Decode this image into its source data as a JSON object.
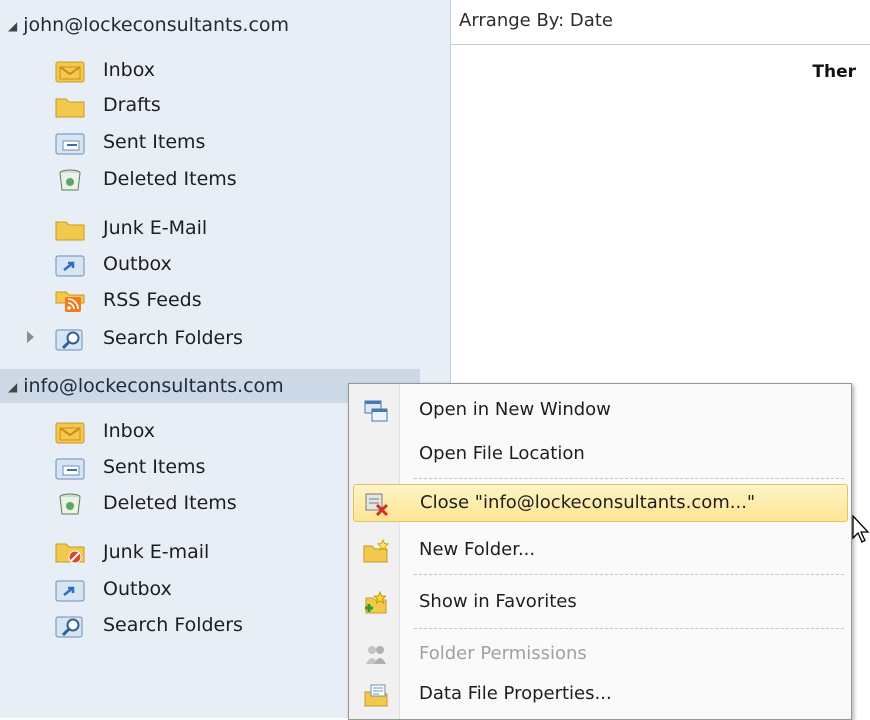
{
  "navigation": {
    "accounts": [
      {
        "name": "john@lockeconsultants.com",
        "folders": [
          {
            "label": "Inbox",
            "icon": "inbox-icon"
          },
          {
            "label": "Drafts",
            "icon": "drafts-icon"
          },
          {
            "label": "Sent Items",
            "icon": "sent-items-icon"
          },
          {
            "label": "Deleted Items",
            "icon": "deleted-items-icon"
          },
          {
            "label": "Junk E-Mail",
            "icon": "junk-folder-icon"
          },
          {
            "label": "Outbox",
            "icon": "outbox-icon"
          },
          {
            "label": "RSS Feeds",
            "icon": "rss-icon"
          },
          {
            "label": "Search Folders",
            "icon": "search-folder-icon"
          }
        ]
      },
      {
        "name": "info@lockeconsultants.com",
        "folders": [
          {
            "label": "Inbox",
            "icon": "inbox-icon"
          },
          {
            "label": "Sent Items",
            "icon": "sent-items-icon"
          },
          {
            "label": "Deleted Items",
            "icon": "deleted-items-icon"
          },
          {
            "label": "Junk E-mail",
            "icon": "junk-blocked-icon"
          },
          {
            "label": "Outbox",
            "icon": "outbox-icon"
          },
          {
            "label": "Search Folders",
            "icon": "search-folder-icon"
          }
        ]
      }
    ]
  },
  "content": {
    "arrange_label": "Arrange By: Date",
    "partial_text": "Ther"
  },
  "context_menu": {
    "items": [
      {
        "label": "Open in New Window",
        "icon": "new-window-icon",
        "enabled": true,
        "highlighted": false
      },
      {
        "label": "Open File Location",
        "icon": "",
        "enabled": true,
        "highlighted": false
      },
      {
        "label": "Close \"info@lockeconsultants.com...\"",
        "icon": "close-datafile-icon",
        "enabled": true,
        "highlighted": true
      },
      {
        "label": "New Folder...",
        "icon": "new-folder-icon",
        "enabled": true,
        "highlighted": false
      },
      {
        "label": "Show in Favorites",
        "icon": "favorites-icon",
        "enabled": true,
        "highlighted": false
      },
      {
        "label": "Folder Permissions",
        "icon": "permissions-icon",
        "enabled": false,
        "highlighted": false
      },
      {
        "label": "Data File Properties...",
        "icon": "properties-icon",
        "enabled": true,
        "highlighted": false
      }
    ]
  },
  "colors": {
    "nav_background": "#e8eef6",
    "selected_account_background": "#cdd8e6",
    "menu_highlight": "#fde593",
    "folder_yellow": "#f2c94c"
  }
}
